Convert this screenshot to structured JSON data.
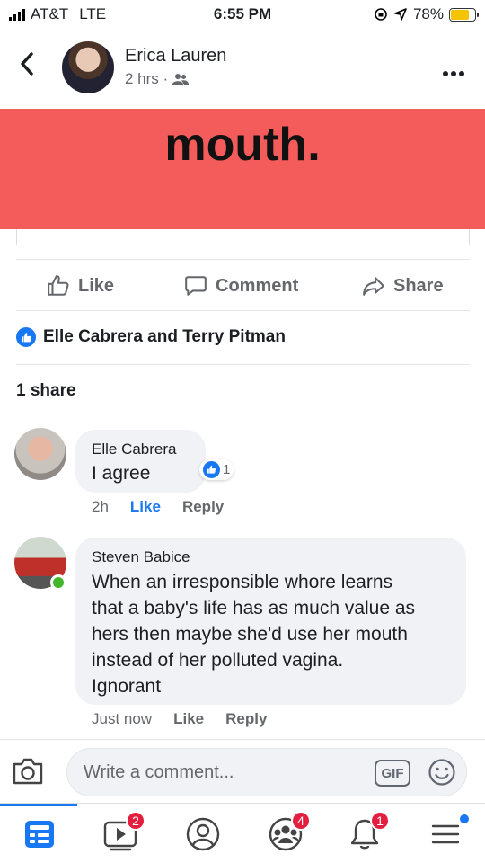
{
  "status_bar": {
    "carrier": "AT&T",
    "network": "LTE",
    "time": "6:55 PM",
    "battery_percent": "78%",
    "battery_level": 0.78
  },
  "post": {
    "author": "Erica Lauren",
    "time": "2 hrs ·",
    "banner_text": "mouth.",
    "banner_color": "#f45b5b"
  },
  "actions": {
    "like": "Like",
    "comment": "Comment",
    "share": "Share"
  },
  "reactions": {
    "names": "Elle Cabrera and Terry Pitman",
    "shares": "1 share"
  },
  "comments": [
    {
      "name": "Elle Cabrera",
      "lines": [
        "I agree"
      ],
      "time": "2h",
      "like": "Like",
      "reply": "Reply",
      "reaction_count": "1"
    },
    {
      "name": "Steven Babice",
      "lines": [
        "When an irresponsible whore learns",
        "that a baby's life has as much value as",
        "hers then maybe she'd use her mouth",
        "instead of her polluted vagina.",
        "Ignorant"
      ],
      "time": "Just now",
      "like": "Like",
      "reply": "Reply"
    }
  ],
  "composer": {
    "placeholder": "Write a comment...",
    "gif": "GIF"
  },
  "tabbar": {
    "watch_badge": "2",
    "groups_badge": "4",
    "notifications_badge": "1"
  },
  "colors": {
    "accent": "#1877f2",
    "badge": "#e41e3f",
    "online": "#42b72a"
  }
}
